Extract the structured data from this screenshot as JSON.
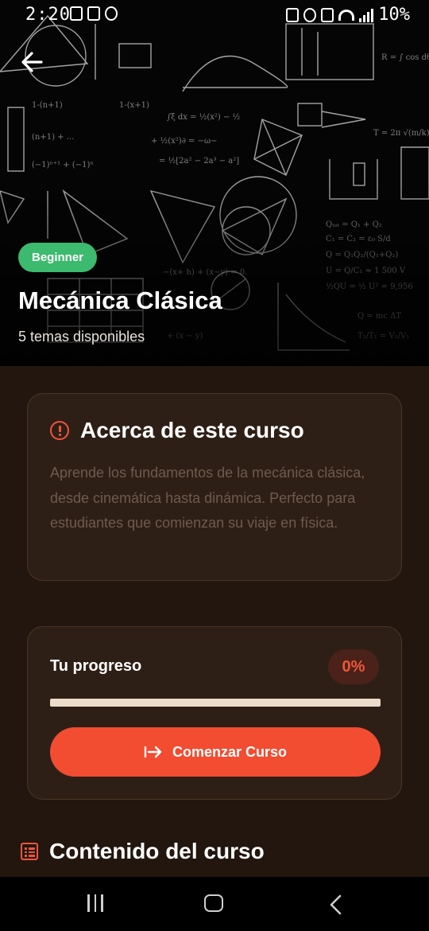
{
  "status_bar": {
    "time": "2:20",
    "battery": "10%"
  },
  "hero": {
    "level_badge": "Beginner",
    "title": "Mecánica Clásica",
    "subtitle": "5 temas disponibles",
    "background_image": "physics-equations-chalkboard"
  },
  "about": {
    "icon": "info-icon",
    "title": "Acerca de este curso",
    "description": "Aprende los fundamentos de la mecánica clásica, desde cinemática hasta dinámica. Perfecto para estudiantes que comienzan su viaje en física."
  },
  "progress": {
    "label": "Tu progreso",
    "percent_text": "0%",
    "value": 0,
    "start_button": "Comenzar Curso",
    "start_icon": "login-arrow-icon"
  },
  "contents": {
    "icon": "list-icon",
    "title": "Contenido del curso"
  },
  "colors": {
    "accent": "#f24c31",
    "badge_green": "#3cba6e",
    "card_bg": "#2e1f16",
    "page_bg": "#22160f"
  },
  "nav_bar": {
    "recents_icon": "recents-icon",
    "home_icon": "home-icon",
    "back_icon": "back-icon"
  }
}
